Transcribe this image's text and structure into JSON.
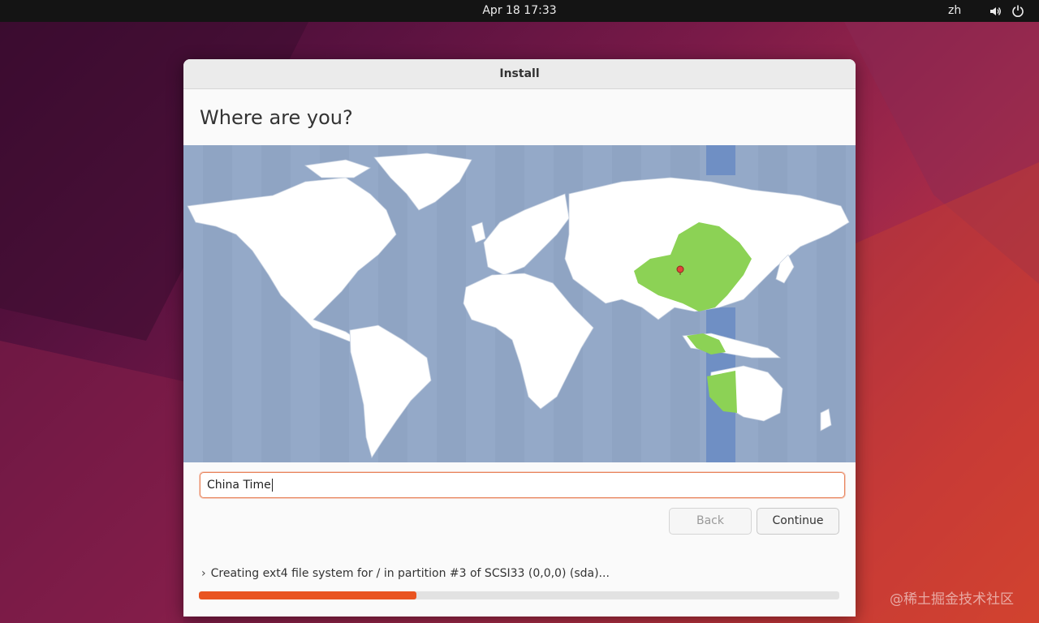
{
  "topbar": {
    "clock": "Apr 18  17:33",
    "input_method": "zh",
    "icons": [
      "volume-icon",
      "power-icon"
    ]
  },
  "window": {
    "title": "Install",
    "heading": "Where are you?"
  },
  "map": {
    "selected_region": "China",
    "colors": {
      "ocean": "#94a9c8",
      "land": "#ffffff",
      "highlight": "#8cd255",
      "tz_band": "#6f8fc4",
      "pin": "#e0453a"
    }
  },
  "timezone": {
    "value": "China Time"
  },
  "buttons": {
    "back": "Back",
    "continue": "Continue"
  },
  "status": {
    "text": "Creating ext4 file system for / in partition #3 of SCSI33 (0,0,0) (sda)...",
    "progress": 0.34
  },
  "colors": {
    "accent": "#e95420"
  },
  "watermark": "@稀土掘金技术社区"
}
